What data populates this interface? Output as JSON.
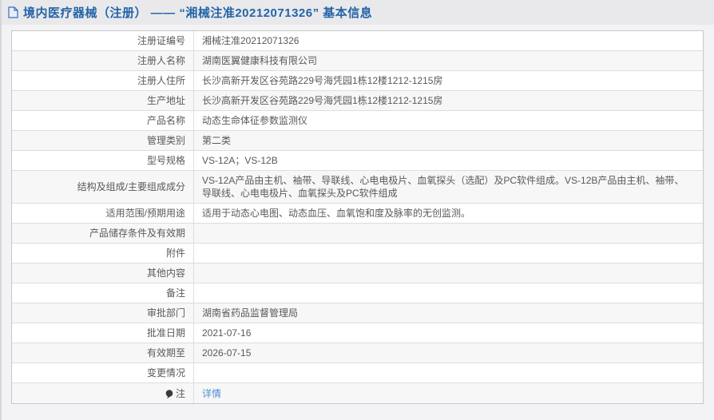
{
  "header": {
    "title": "境内医疗器械（注册） —— “湘械注准20212071326” 基本信息",
    "icon": "document-icon"
  },
  "colors": {
    "title_blue": "#2464a8",
    "link_blue": "#4c8fd4",
    "text_gray": "#595959",
    "stripe_gray": "#f7f7f7",
    "header_bar": "#e9e9eb"
  },
  "table": {
    "rows": [
      {
        "label": "注册证编号",
        "value": "湘械注准20212071326"
      },
      {
        "label": "注册人名称",
        "value": "湖南医翼健康科技有限公司"
      },
      {
        "label": "注册人住所",
        "value": "长沙高新开发区谷苑路229号海凭园1栋12楼1212-1215房"
      },
      {
        "label": "生产地址",
        "value": "长沙高新开发区谷苑路229号海凭园1栋12楼1212-1215房"
      },
      {
        "label": "产品名称",
        "value": "动态生命体征参数监测仪"
      },
      {
        "label": "管理类别",
        "value": "第二类"
      },
      {
        "label": "型号规格",
        "value": "VS-12A；VS-12B"
      },
      {
        "label": "结构及组成/主要组成成分",
        "value": "VS-12A产品由主机、袖带、导联线、心电电极片、血氧探头（选配）及PC软件组成。VS-12B产品由主机、袖带、导联线、心电电极片、血氧探头及PC软件组成"
      },
      {
        "label": "适用范围/预期用途",
        "value": "适用于动态心电图、动态血压、血氧饱和度及脉率的无创监测。"
      },
      {
        "label": "产品储存条件及有效期",
        "value": ""
      },
      {
        "label": "附件",
        "value": ""
      },
      {
        "label": "其他内容",
        "value": ""
      },
      {
        "label": "备注",
        "value": ""
      },
      {
        "label": "审批部门",
        "value": "湖南省药品监督管理局"
      },
      {
        "label": "批准日期",
        "value": "2021-07-16"
      },
      {
        "label": "有效期至",
        "value": "2026-07-15"
      },
      {
        "label": "变更情况",
        "value": ""
      },
      {
        "label": "注",
        "value": "详情",
        "icon": "balloon-icon",
        "link": true
      }
    ]
  }
}
